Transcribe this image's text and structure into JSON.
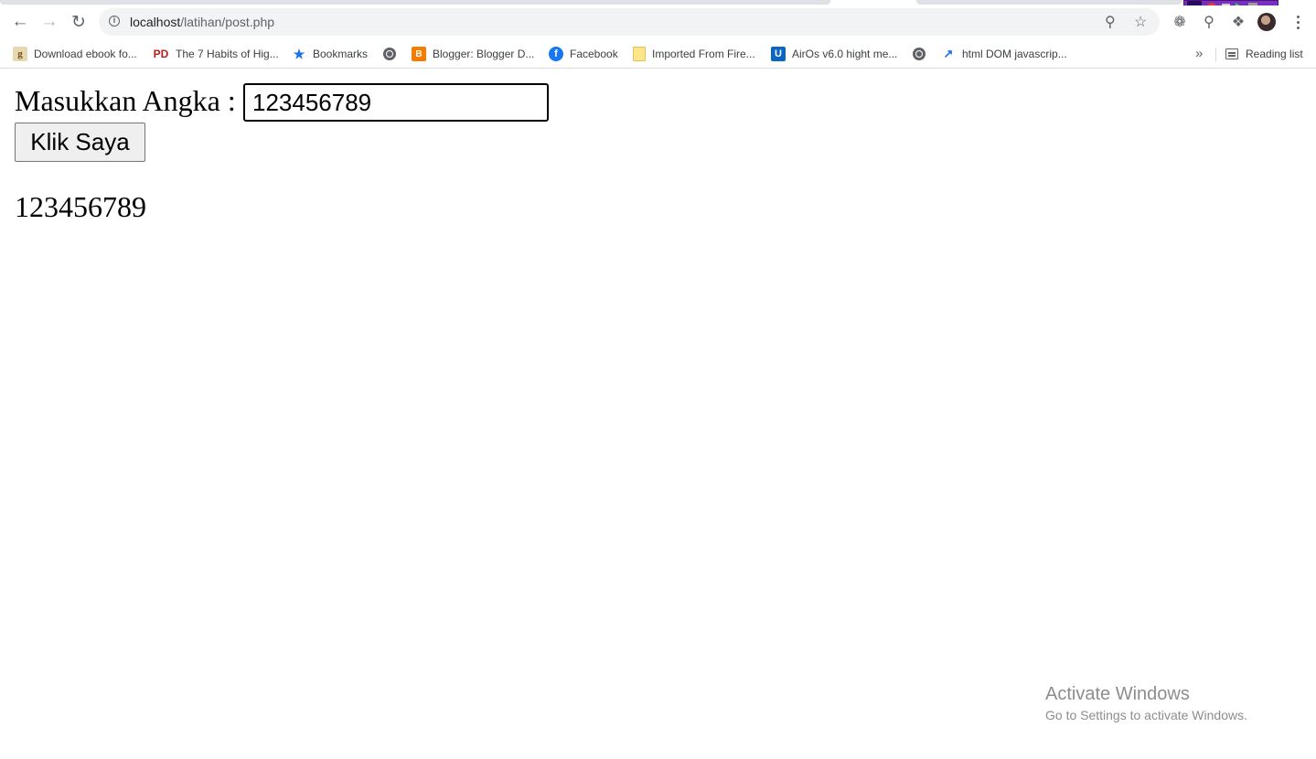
{
  "browser": {
    "url_host": "localhost",
    "url_path": "/latihan/post.php",
    "bookmarks": [
      {
        "label": "Download ebook fo...",
        "icon": "g-favicon"
      },
      {
        "label": "The 7 Habits of Hig...",
        "icon": "pd-favicon"
      },
      {
        "label": "Bookmarks",
        "icon": "star-icon"
      },
      {
        "label": "",
        "icon": "globe-icon"
      },
      {
        "label": "Blogger: Blogger D...",
        "icon": "blogger-favicon"
      },
      {
        "label": "Facebook",
        "icon": "facebook-favicon"
      },
      {
        "label": "Imported From Fire...",
        "icon": "folder-icon"
      },
      {
        "label": "AirOs v6.0 hight me...",
        "icon": "u-favicon"
      },
      {
        "label": "",
        "icon": "globe-icon"
      },
      {
        "label": "html DOM javascrip...",
        "icon": "trend-favicon"
      }
    ],
    "reading_list": "Reading list"
  },
  "form": {
    "label": "Masukkan Angka :",
    "input_value": "123456789",
    "button_label": "Klik Saya"
  },
  "result": {
    "output": "123456789"
  },
  "watermark": {
    "title": "Activate Windows",
    "subtitle": "Go to Settings to activate Windows."
  }
}
